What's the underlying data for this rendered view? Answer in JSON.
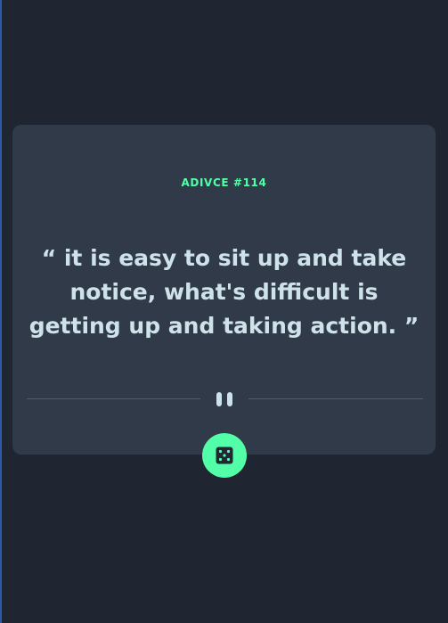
{
  "advice": {
    "id_label": "ADIVCE #114",
    "text": "“ it is easy to sit up and take notice, what's difficult is getting up and taking action. ”"
  },
  "icons": {
    "divider": "pause-icon",
    "button": "dice-icon"
  },
  "colors": {
    "background": "#1f2631",
    "card": "#313a49",
    "accent": "#52ffa8",
    "text": "#cee3e9",
    "divider": "#4f5d74"
  }
}
